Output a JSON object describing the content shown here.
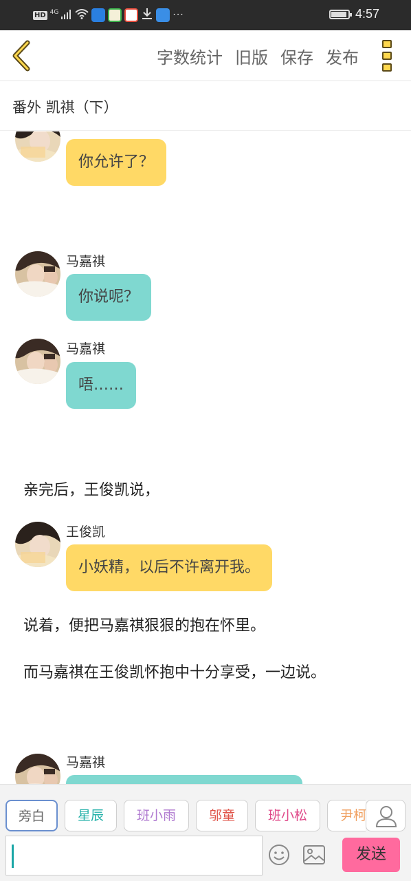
{
  "status_bar": {
    "hd": "HD",
    "network": "4G",
    "more": "···",
    "time": "4:57"
  },
  "toolbar": {
    "actions": [
      "字数统计",
      "旧版",
      "保存",
      "发布"
    ]
  },
  "chapter": {
    "title": "番外   凯祺（下）"
  },
  "messages": [
    {
      "speaker": "",
      "text": "你允许了？",
      "color": "#ffd966"
    },
    {
      "speaker": "马嘉祺",
      "text": "你说呢？",
      "color": "#7fd8d0"
    },
    {
      "speaker": "马嘉祺",
      "text": "唔……",
      "color": "#7fd8d0"
    },
    {
      "speaker": "王俊凯",
      "text": "小妖精，以后不许离开我。",
      "color": "#ffd966"
    },
    {
      "speaker": "马嘉祺",
      "text": "",
      "color": "#7fd8d0"
    }
  ],
  "narration": [
    "亲完后，王俊凯说，",
    "说着，便把马嘉祺狠狠的抱在怀里。",
    "而马嘉祺在王俊凯怀抱中十分享受，一边说。"
  ],
  "characters": [
    {
      "name": "旁白",
      "color": "#666666"
    },
    {
      "name": "星辰",
      "color": "#22b0a8"
    },
    {
      "name": "班小雨",
      "color": "#b07ad0"
    },
    {
      "name": "邬童",
      "color": "#e0544a"
    },
    {
      "name": "班小松",
      "color": "#e04a8a"
    },
    {
      "name": "尹柯",
      "color": "#f0a060"
    }
  ],
  "composer": {
    "send_label": "发送"
  },
  "colors": {
    "accent_yellow": "#ffd966",
    "accent_teal": "#7fd8d0",
    "send_pink": "#ff6a9e"
  }
}
